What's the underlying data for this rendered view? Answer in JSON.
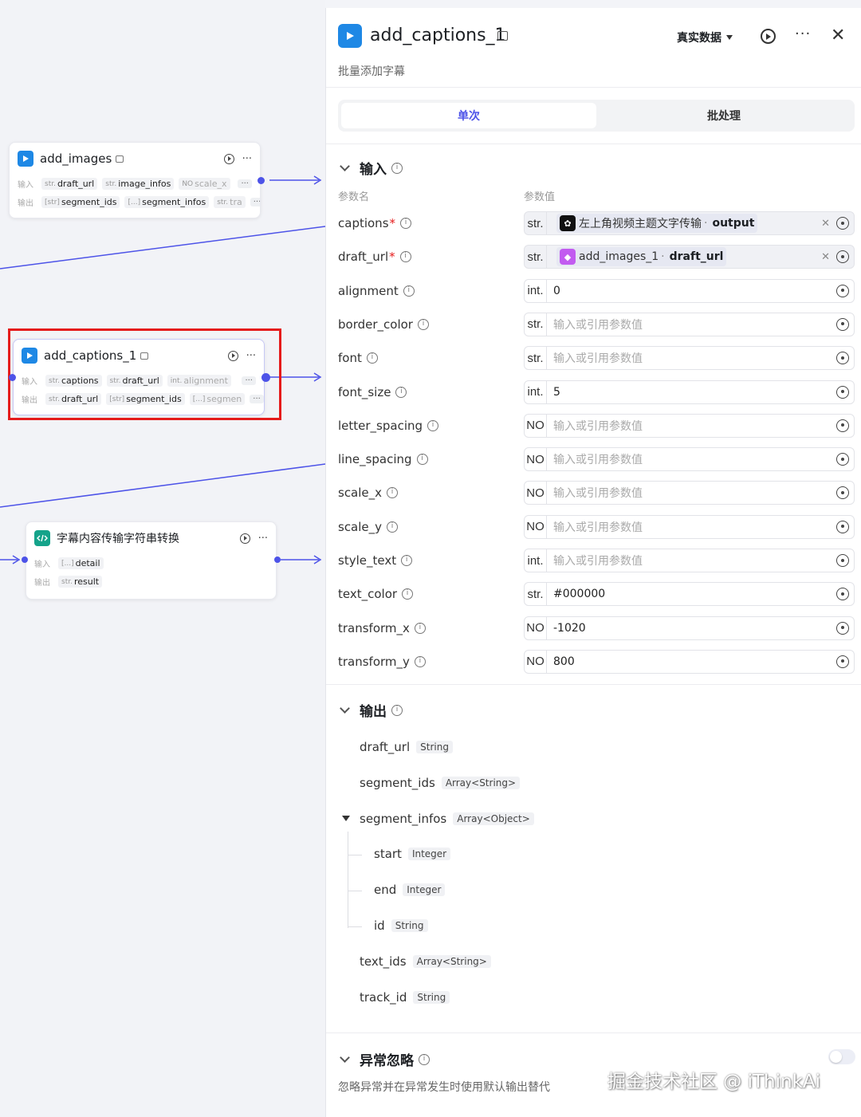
{
  "canvas": {
    "nodes": {
      "add_images": {
        "title": "add_images",
        "input_label": "输入",
        "output_label": "输出",
        "inputs": [
          {
            "type": "str.",
            "name": "draft_url"
          },
          {
            "type": "str.",
            "name": "image_infos"
          },
          {
            "type": "NO",
            "name": "scale_x"
          }
        ],
        "outputs": [
          {
            "type": "[str]",
            "name": "segment_ids"
          },
          {
            "type": "[...]",
            "name": "segment_infos"
          },
          {
            "type": "str.",
            "name": "tra"
          }
        ],
        "more": "···"
      },
      "add_captions": {
        "title": "add_captions_1",
        "input_label": "输入",
        "output_label": "输出",
        "inputs": [
          {
            "type": "str.",
            "name": "captions"
          },
          {
            "type": "str.",
            "name": "draft_url"
          },
          {
            "type": "int.",
            "name": "alignment"
          }
        ],
        "outputs": [
          {
            "type": "str.",
            "name": "draft_url"
          },
          {
            "type": "[str]",
            "name": "segment_ids"
          },
          {
            "type": "[...]",
            "name": "segmen"
          }
        ],
        "more": "···"
      },
      "convert": {
        "title": "字幕内容传输字符串转换",
        "input_label": "输入",
        "output_label": "输出",
        "inputs": [
          {
            "type": "[...]",
            "name": "detail"
          }
        ],
        "outputs": [
          {
            "type": "str.",
            "name": "result"
          }
        ]
      }
    }
  },
  "panel": {
    "title": "add_captions_1",
    "subtitle": "批量添加字幕",
    "data_mode": "真实数据",
    "more": "···",
    "close": "✕",
    "tabs": [
      {
        "label": "单次",
        "active": true
      },
      {
        "label": "批处理",
        "active": false
      }
    ],
    "input_section": {
      "title": "输入",
      "col_name": "参数名",
      "col_value": "参数值",
      "params": [
        {
          "name": "captions",
          "required": true,
          "type": "str.",
          "ref": {
            "icon": "black",
            "source": "左上角视频主题文字传输",
            "field": "output"
          }
        },
        {
          "name": "draft_url",
          "required": true,
          "type": "str.",
          "ref": {
            "icon": "purple",
            "source": "add_images_1",
            "field": "draft_url"
          }
        },
        {
          "name": "alignment",
          "required": false,
          "type": "int.",
          "value": "0"
        },
        {
          "name": "border_color",
          "required": false,
          "type": "str.",
          "placeholder": "输入或引用参数值"
        },
        {
          "name": "font",
          "required": false,
          "type": "str.",
          "placeholder": "输入或引用参数值"
        },
        {
          "name": "font_size",
          "required": false,
          "type": "int.",
          "value": "5"
        },
        {
          "name": "letter_spacing",
          "required": false,
          "type": "NO",
          "placeholder": "输入或引用参数值"
        },
        {
          "name": "line_spacing",
          "required": false,
          "type": "NO",
          "placeholder": "输入或引用参数值"
        },
        {
          "name": "scale_x",
          "required": false,
          "type": "NO",
          "placeholder": "输入或引用参数值"
        },
        {
          "name": "scale_y",
          "required": false,
          "type": "NO",
          "placeholder": "输入或引用参数值"
        },
        {
          "name": "style_text",
          "required": false,
          "type": "int.",
          "placeholder": "输入或引用参数值"
        },
        {
          "name": "text_color",
          "required": false,
          "type": "str.",
          "value": "#000000"
        },
        {
          "name": "transform_x",
          "required": false,
          "type": "NO",
          "value": "-1020"
        },
        {
          "name": "transform_y",
          "required": false,
          "type": "NO",
          "value": "800"
        }
      ]
    },
    "output_section": {
      "title": "输出",
      "items": [
        {
          "name": "draft_url",
          "type": "String",
          "level": 0
        },
        {
          "name": "segment_ids",
          "type": "Array<String>",
          "level": 0
        },
        {
          "name": "segment_infos",
          "type": "Array<Object>",
          "level": 0,
          "expanded": true
        },
        {
          "name": "start",
          "type": "Integer",
          "level": 1
        },
        {
          "name": "end",
          "type": "Integer",
          "level": 1
        },
        {
          "name": "id",
          "type": "String",
          "level": 1
        },
        {
          "name": "text_ids",
          "type": "Array<String>",
          "level": 0
        },
        {
          "name": "track_id",
          "type": "String",
          "level": 0
        }
      ]
    },
    "exception_section": {
      "title": "异常忽略",
      "description": "忽略异常并在异常发生时使用默认输出替代",
      "enabled": false
    }
  },
  "watermark": "掘金技术社区 @ iThinkAi",
  "colors": {
    "accent": "#4d53e8",
    "highlight": "#e51b1b",
    "node_blue": "#1e88e5",
    "node_green": "#15a38a"
  }
}
